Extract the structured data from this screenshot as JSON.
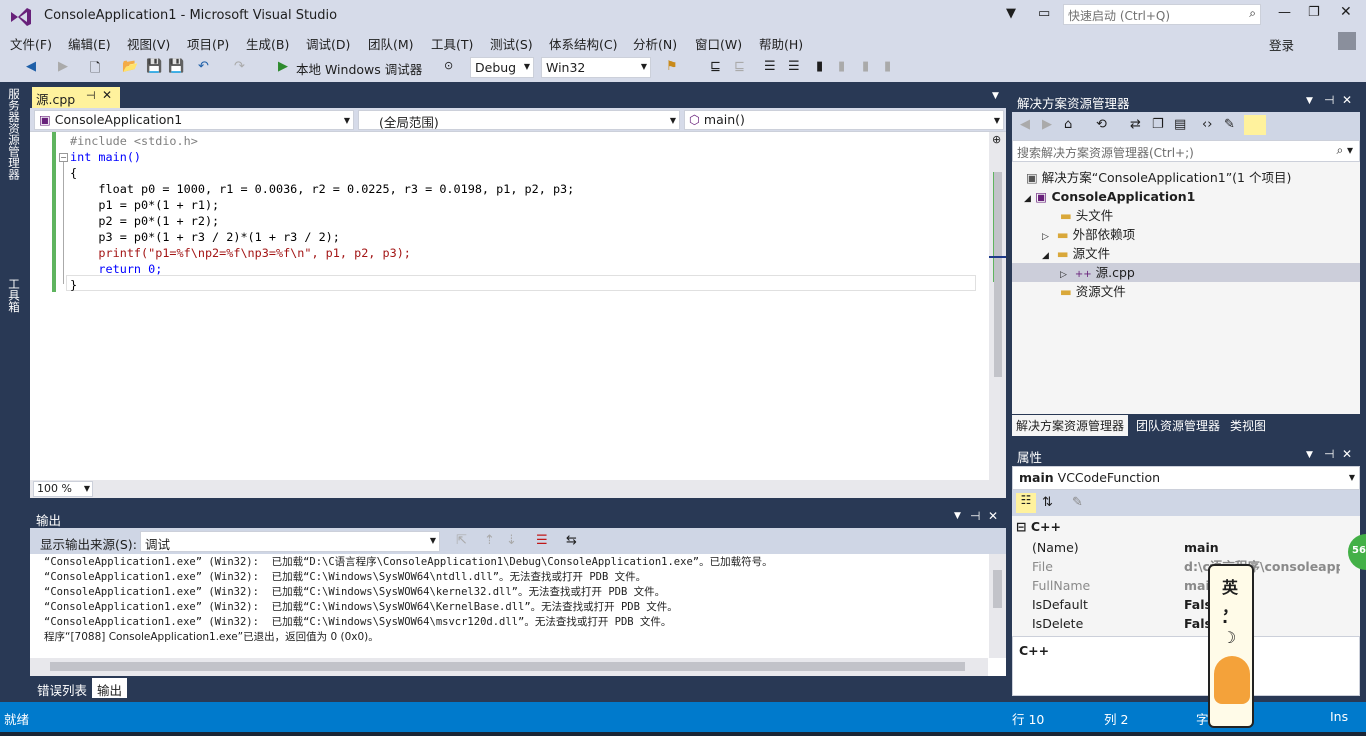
{
  "window": {
    "title": "ConsoleApplication1 - Microsoft Visual Studio",
    "quick_launch_placeholder": "快速启动 (Ctrl+Q)",
    "login": "登录"
  },
  "menu": [
    "文件(F)",
    "编辑(E)",
    "视图(V)",
    "项目(P)",
    "生成(B)",
    "调试(D)",
    "团队(M)",
    "工具(T)",
    "测试(S)",
    "体系结构(C)",
    "分析(N)",
    "窗口(W)",
    "帮助(H)"
  ],
  "toolbar": {
    "start_debug": "本地 Windows 调试器",
    "config": "Debug",
    "platform": "Win32"
  },
  "side_tabs": [
    "服务器资源管理器",
    "工具箱"
  ],
  "editor": {
    "tab_label": "源.cpp",
    "nav_project": "ConsoleApplication1",
    "nav_scope": "(全局范围)",
    "nav_member": "main()",
    "zoom": "100 %",
    "lines": [
      "#include <stdio.h>",
      "int main()",
      "{",
      "    float p0 = 1000, r1 = 0.0036, r2 = 0.0225, r3 = 0.0198, p1, p2, p3;",
      "    p1 = p0*(1 + r1);",
      "    p2 = p0*(1 + r2);",
      "    p3 = p0*(1 + r3 / 2)*(1 + r3 / 2);",
      "    printf(\"p1=%f\\np2=%f\\np3=%f\\n\", p1, p2, p3);",
      "    return 0;",
      "}"
    ]
  },
  "output": {
    "title": "输出",
    "source_label": "显示输出来源(S):",
    "source_value": "调试",
    "lines": [
      "“ConsoleApplication1.exe” (Win32):  已加载“D:\\C语言程序\\ConsoleApplication1\\Debug\\ConsoleApplication1.exe”。已加载符号。",
      "“ConsoleApplication1.exe” (Win32):  已加载“C:\\Windows\\SysWOW64\\ntdll.dll”。无法查找或打开 PDB 文件。",
      "“ConsoleApplication1.exe” (Win32):  已加载“C:\\Windows\\SysWOW64\\kernel32.dll”。无法查找或打开 PDB 文件。",
      "“ConsoleApplication1.exe” (Win32):  已加载“C:\\Windows\\SysWOW64\\KernelBase.dll”。无法查找或打开 PDB 文件。",
      "“ConsoleApplication1.exe” (Win32):  已加载“C:\\Windows\\SysWOW64\\msvcr120d.dll”。无法查找或打开 PDB 文件。",
      "程序“[7088] ConsoleApplication1.exe”已退出，返回值为 0 (0x0)。"
    ],
    "bottom_tabs": [
      "错误列表",
      "输出"
    ]
  },
  "solution_explorer": {
    "title": "解决方案资源管理器",
    "search_placeholder": "搜索解决方案资源管理器(Ctrl+;)",
    "solution": "解决方案“ConsoleApplication1”(1 个项目)",
    "project": "ConsoleApplication1",
    "nodes": [
      "头文件",
      "外部依赖项",
      "源文件",
      "源.cpp",
      "资源文件"
    ],
    "tabs": [
      "解决方案资源管理器",
      "团队资源管理器",
      "类视图"
    ]
  },
  "properties": {
    "title": "属性",
    "object_name": "main",
    "object_type": "VCCodeFunction",
    "category": "C++",
    "rows": [
      {
        "name": "(Name)",
        "value": "main"
      },
      {
        "name": "File",
        "value": "d:\\c语言程序\\consoleapplic"
      },
      {
        "name": "FullName",
        "value": "main"
      },
      {
        "name": "IsDefault",
        "value": "False"
      },
      {
        "name": "IsDelete",
        "value": "False"
      }
    ],
    "description": "C++"
  },
  "status": {
    "ready": "就绪",
    "line": "行 10",
    "col": "列 2",
    "char": "字",
    "mode": "Ins"
  },
  "ime": {
    "chars": [
      "英",
      "，",
      "·",
      "☽"
    ]
  },
  "badge": "56",
  "colors": {
    "accent": "#007acc",
    "chrome": "#d6dbe9",
    "dark": "#293955",
    "tab_active": "#fff29d"
  }
}
